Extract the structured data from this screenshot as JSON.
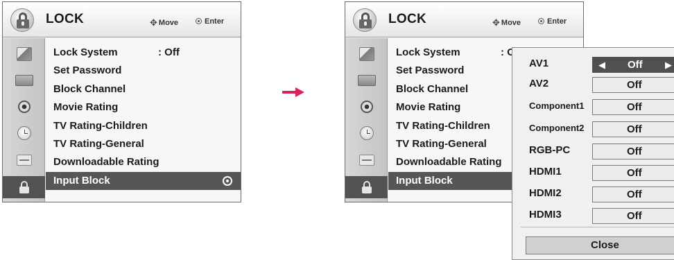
{
  "colors": {
    "arrow": "#d6245a",
    "active": "#565656"
  },
  "left_menu": {
    "title": "LOCK",
    "move_hint": "Move",
    "enter_hint": "Enter",
    "items": [
      {
        "label": "Lock System",
        "value": ": Off"
      },
      {
        "label": "Set Password"
      },
      {
        "label": "Block Channel"
      },
      {
        "label": "Movie Rating"
      },
      {
        "label": "TV Rating-Children"
      },
      {
        "label": "TV Rating-General"
      },
      {
        "label": "Downloadable Rating"
      },
      {
        "label": "Input Block"
      }
    ],
    "sidebar_icons": [
      "picture-icon",
      "screen-icon",
      "audio-icon",
      "time-icon",
      "option-icon",
      "lock-icon"
    ]
  },
  "right_menu": {
    "title": "LOCK",
    "move_hint": "Move",
    "enter_hint": "Enter",
    "items": [
      {
        "label": "Lock System",
        "value": ": Of"
      },
      {
        "label": "Set Password"
      },
      {
        "label": "Block Channel"
      },
      {
        "label": "Movie Rating"
      },
      {
        "label": "TV Rating-Children"
      },
      {
        "label": "TV Rating-General"
      },
      {
        "label": "Downloadable Rating"
      },
      {
        "label": "Input Block"
      }
    ]
  },
  "input_block_popup": {
    "rows": [
      {
        "label": "AV1",
        "value": "Off"
      },
      {
        "label": "AV2",
        "value": "Off"
      },
      {
        "label": "Component1",
        "value": "Off"
      },
      {
        "label": "Component2",
        "value": "Off"
      },
      {
        "label": "RGB-PC",
        "value": "Off"
      },
      {
        "label": "HDMI1",
        "value": "Off"
      },
      {
        "label": "HDMI2",
        "value": "Off"
      },
      {
        "label": "HDMI3",
        "value": "Off"
      }
    ],
    "close_label": "Close"
  }
}
